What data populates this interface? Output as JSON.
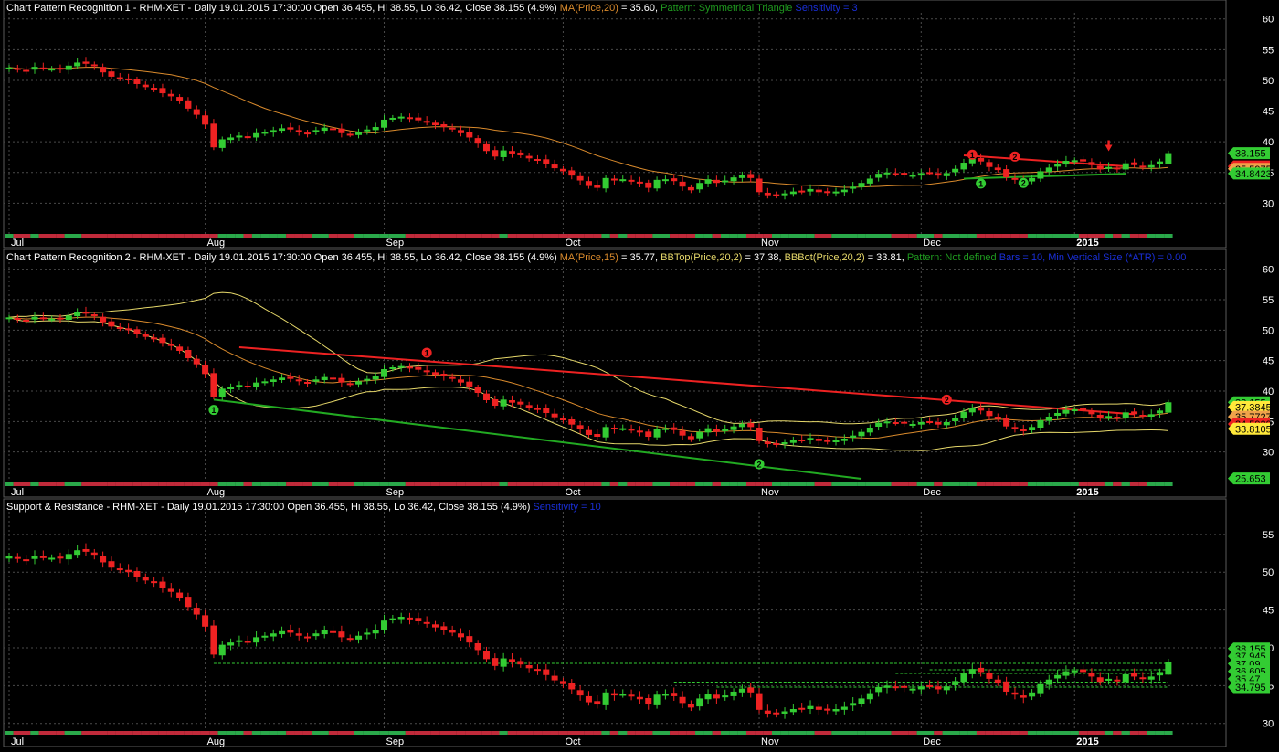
{
  "colors": {
    "background": "#000000",
    "grid": "#4a4a4a",
    "up": "#33cc33",
    "down": "#ee2222",
    "ma": "#d98a2c",
    "band": "#e6d86a",
    "resistance": "#ee2222",
    "support": "#22aa22",
    "blue_text": "#1a2fd8",
    "green_text": "#1f9a1f"
  },
  "x_months": [
    {
      "label": "Jul",
      "day": 0
    },
    {
      "label": "Aug",
      "day": 23
    },
    {
      "label": "Sep",
      "day": 44
    },
    {
      "label": "Oct",
      "day": 65
    },
    {
      "label": "Nov",
      "day": 88
    },
    {
      "label": "Dec",
      "day": 107
    },
    {
      "label": "2015",
      "day": 125
    }
  ],
  "panels": [
    {
      "id": "p1",
      "header": [
        {
          "text": "Chart Pattern Recognition 1  - RHM-XET - Daily 19.01.2015 17:30:00 Open 36.455, Hi 38.55, Lo 36.42, Close 38.155 (4.9%) ",
          "color": "#ffffff"
        },
        {
          "text": "MA(Price,20)",
          "color": "#d98a2c"
        },
        {
          "text": " = 35.60, ",
          "color": "#ffffff"
        },
        {
          "text": "Pattern: Symmetrical Triangle",
          "color": "#1f9a1f"
        },
        {
          "text": "  Sensitivity = 3",
          "color": "#1a2fd8"
        }
      ],
      "ylim": [
        25,
        61
      ],
      "ticks": [
        30,
        35,
        40,
        45,
        50,
        55,
        60
      ],
      "badges": [
        {
          "text": "38.155",
          "value": 38.155,
          "bg": "#33cc33",
          "fg": "#000000"
        },
        {
          "text": "35.9853",
          "value": 35.9853,
          "bg": "#ee2222",
          "fg": "#000000"
        },
        {
          "text": "35.5975",
          "value": 35.5975,
          "bg": "#f0a24a",
          "fg": "#000000"
        },
        {
          "text": "34.8423",
          "value": 34.8423,
          "bg": "#33cc33",
          "fg": "#000000"
        }
      ],
      "markers": [
        {
          "text": "1",
          "color": "#ee2222",
          "day": 113,
          "value": 37.9
        },
        {
          "text": "2",
          "color": "#ee2222",
          "day": 118,
          "value": 37.6
        },
        {
          "text": "1",
          "color": "#33cc33",
          "day": 114,
          "value": 33.2
        },
        {
          "text": "2",
          "color": "#33cc33",
          "day": 119,
          "value": 33.3
        }
      ]
    },
    {
      "id": "p2",
      "header": [
        {
          "text": "Chart Pattern Recognition 2 - RHM-XET - Daily 19.01.2015 17:30:00 Open 36.455, Hi 38.55, Lo 36.42, Close 38.155 (4.9%) ",
          "color": "#ffffff"
        },
        {
          "text": "MA(Price,15)",
          "color": "#d98a2c"
        },
        {
          "text": " = 35.77, ",
          "color": "#ffffff"
        },
        {
          "text": "BBTop(Price,20,2)",
          "color": "#e6d86a"
        },
        {
          "text": " = 37.38, ",
          "color": "#ffffff"
        },
        {
          "text": "BBBot(Price,20,2)",
          "color": "#e6d86a"
        },
        {
          "text": " = 33.81, ",
          "color": "#ffffff"
        },
        {
          "text": "Pattern: Not defined",
          "color": "#1f9a1f"
        },
        {
          "text": "  Bars = 10, Min Vertical Size (*ATR) = 0.00",
          "color": "#1a2fd8"
        }
      ],
      "ylim": [
        25,
        61
      ],
      "ticks": [
        30,
        35,
        40,
        45,
        50,
        55,
        60
      ],
      "badges": [
        {
          "text": "38.155",
          "value": 38.155,
          "bg": "#33cc33",
          "fg": "#000000"
        },
        {
          "text": "37.3845",
          "value": 37.3845,
          "bg": "#ffe83a",
          "fg": "#000000"
        },
        {
          "text": "35.7727",
          "value": 35.7727,
          "bg": "#f0a24a",
          "fg": "#000000"
        },
        {
          "text": "34.5929",
          "value": 34.5929,
          "bg": "#ee2222",
          "fg": "#000000"
        },
        {
          "text": "33.8105",
          "value": 33.8105,
          "bg": "#ffe83a",
          "fg": "#000000"
        },
        {
          "text": "25.653",
          "value": 25.653,
          "bg": "#33cc33",
          "fg": "#000000"
        }
      ],
      "markers": [
        {
          "text": "1",
          "color": "#ee2222",
          "day": 49,
          "value": 46.3
        },
        {
          "text": "2",
          "color": "#ee2222",
          "day": 110,
          "value": 38.6
        },
        {
          "text": "1",
          "color": "#33cc33",
          "day": 24,
          "value": 36.9
        },
        {
          "text": "2",
          "color": "#33cc33",
          "day": 88,
          "value": 28.0
        }
      ]
    },
    {
      "id": "p3",
      "header": [
        {
          "text": "Support & Resistance - RHM-XET - Daily 19.01.2015 17:30:00 Open 36.455, Hi 38.55, Lo 36.42, Close 38.155 (4.9%) ",
          "color": "#ffffff"
        },
        {
          "text": "Sensitivity = 10",
          "color": "#1a2fd8"
        }
      ],
      "ylim": [
        29,
        58
      ],
      "ticks": [
        30,
        35,
        40,
        45,
        50,
        55
      ],
      "badges": [
        {
          "text": "38.155",
          "value": 39.9,
          "bg": "#33cc33",
          "fg": "#000000"
        },
        {
          "text": "37.945",
          "value": 38.9,
          "bg": "#33cc33",
          "fg": "#000000"
        },
        {
          "text": "37.09",
          "value": 37.9,
          "bg": "#33cc33",
          "fg": "#000000"
        },
        {
          "text": "36.605",
          "value": 36.9,
          "bg": "#33cc33",
          "fg": "#000000"
        },
        {
          "text": "35.47",
          "value": 35.9,
          "bg": "#33cc33",
          "fg": "#000000"
        },
        {
          "text": "34.795",
          "value": 34.8,
          "bg": "#33cc33",
          "fg": "#000000"
        }
      ],
      "markers": []
    }
  ],
  "chart_data": {
    "type": "candlestick",
    "symbol": "RHM-XET",
    "x_range_days": [
      0,
      133
    ],
    "closes": [
      52.1,
      51.8,
      51.6,
      52.2,
      52.0,
      51.9,
      51.8,
      52.4,
      52.9,
      52.7,
      52.3,
      51.3,
      50.6,
      50.4,
      50.0,
      49.4,
      48.9,
      48.6,
      47.9,
      47.4,
      46.6,
      45.4,
      44.4,
      42.8,
      39.1,
      40.4,
      40.7,
      41.0,
      40.8,
      41.4,
      41.6,
      41.9,
      42.2,
      42.0,
      41.6,
      41.4,
      41.9,
      42.3,
      42.0,
      41.4,
      41.2,
      41.6,
      42.0,
      42.4,
      43.6,
      43.9,
      44.1,
      43.8,
      43.5,
      43.2,
      42.7,
      42.4,
      42.0,
      41.4,
      40.7,
      39.7,
      38.5,
      37.6,
      38.6,
      38.1,
      37.8,
      37.3,
      37.0,
      36.4,
      35.7,
      35.2,
      34.5,
      33.7,
      32.8,
      32.5,
      34.1,
      33.7,
      33.9,
      33.6,
      33.2,
      32.5,
      33.8,
      33.9,
      33.6,
      32.7,
      32.1,
      33.3,
      33.9,
      33.3,
      33.7,
      34.2,
      34.6,
      34.1,
      31.8,
      31.3,
      31.4,
      31.6,
      31.9,
      32.0,
      32.3,
      31.8,
      31.7,
      31.9,
      32.2,
      32.7,
      33.3,
      34.0,
      34.8,
      35.0,
      34.8,
      34.7,
      34.6,
      34.9,
      35.0,
      34.5,
      34.9,
      35.6,
      36.6,
      37.2,
      36.8,
      35.9,
      35.4,
      34.2,
      33.8,
      33.4,
      34.1,
      35.2,
      35.8,
      36.4,
      36.9,
      37.0,
      36.8,
      36.2,
      35.5,
      35.9,
      35.6,
      36.5,
      36.2,
      35.9,
      36.2,
      36.8,
      38.155
    ],
    "series": [
      {
        "name": "MA(Price,20)",
        "panel": 1,
        "last": 35.6
      },
      {
        "name": "MA(Price,15)",
        "panel": 2,
        "last": 35.77
      },
      {
        "name": "BBTop(Price,20,2)",
        "panel": 2,
        "last": 37.38
      },
      {
        "name": "BBBot(Price,20,2)",
        "panel": 2,
        "last": 33.81
      }
    ],
    "patterns": {
      "p1_resistance": [
        [
          112,
          37.8
        ],
        [
          131,
          36.0
        ]
      ],
      "p1_support": [
        [
          112,
          34.0
        ],
        [
          131,
          34.8
        ]
      ],
      "p2_resistance": [
        [
          27,
          47.2
        ],
        [
          132,
          36.2
        ]
      ],
      "p2_support": [
        [
          24,
          38.6
        ],
        [
          100,
          25.6
        ]
      ]
    },
    "levels_p3": [
      {
        "value": 37.945,
        "from_day": 24
      },
      {
        "value": 37.09,
        "from_day": 108
      },
      {
        "value": 36.605,
        "from_day": 104
      },
      {
        "value": 35.47,
        "from_day": 78
      },
      {
        "value": 34.795,
        "from_day": 83
      }
    ],
    "grid": true
  }
}
